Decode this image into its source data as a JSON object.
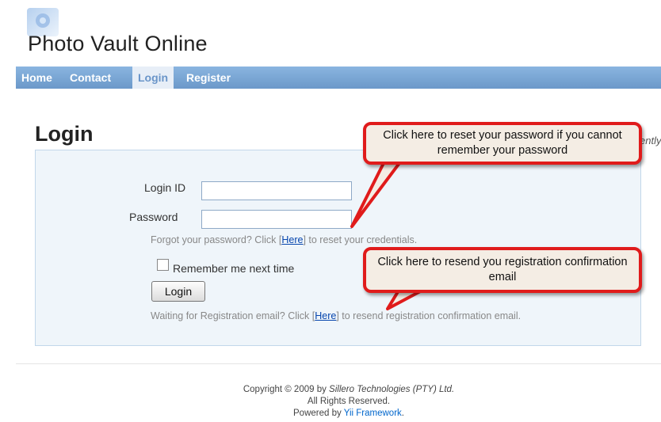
{
  "header": {
    "site_title": "Photo Vault Online"
  },
  "nav": {
    "items": [
      "Home",
      "Contact",
      "Login",
      "Register"
    ],
    "active": "Login"
  },
  "page": {
    "title": "Login",
    "cut_text": "ently"
  },
  "form": {
    "login_id_label": "Login ID",
    "login_id_value": "",
    "password_label": "Password",
    "password_value": "",
    "forgot_prefix": "Forgot your password?  Click [",
    "forgot_link": "Here",
    "forgot_suffix": "] to reset your credentials.",
    "remember_label": "Remember me next time",
    "remember_checked": false,
    "login_button": "Login",
    "resend_prefix": "Waiting for Registration email?  Click [",
    "resend_link": "Here",
    "resend_suffix": "] to resend registration confirmation email."
  },
  "callouts": {
    "reset": "Click here to reset your password if you cannot remember your password",
    "resend": "Click here to resend you registration confirmation email"
  },
  "footer": {
    "copyright_prefix": "Copyright © 2009 by ",
    "company": "Sillero Technologies (PTY) Ltd.",
    "rights": "All Rights Reserved.",
    "powered_prefix": "Powered by ",
    "powered_link": "Yii Framework",
    "powered_suffix": "."
  },
  "colors": {
    "nav_bg": "#7aa7d6",
    "form_bg": "#eff5fa",
    "callout_border": "#e01b1b",
    "callout_fill": "#f4ede4"
  },
  "icons": {
    "logo": "photo-vault-logo-icon",
    "checkbox": "checkbox-unchecked-icon"
  }
}
